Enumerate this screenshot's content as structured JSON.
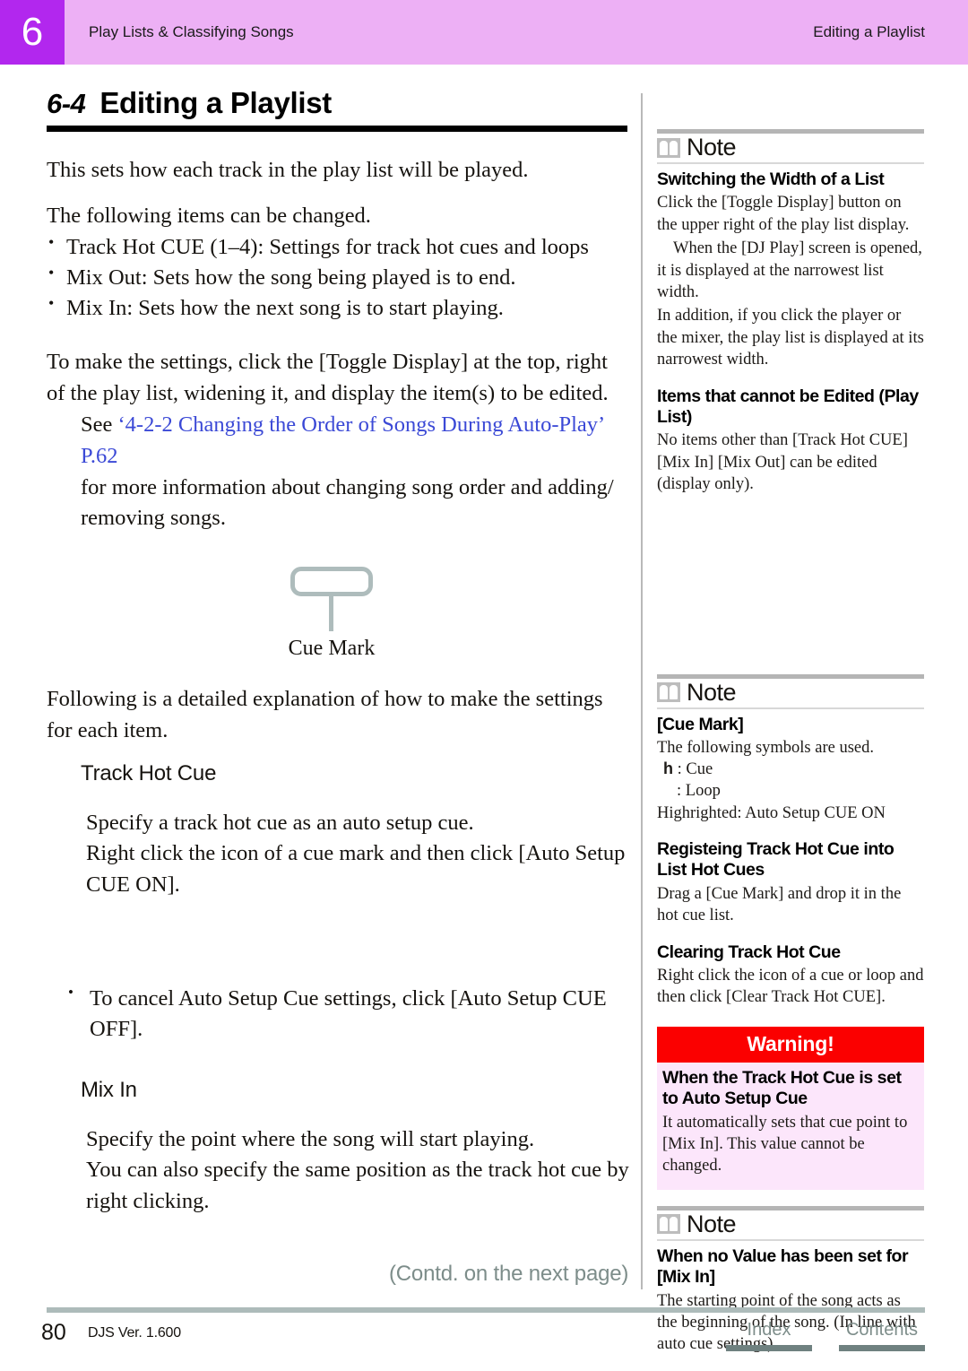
{
  "header": {
    "chapter_number": "6",
    "chapter_title": "Play Lists & Classifying Songs",
    "section_title": "Editing a Playlist",
    "band_color": "#edb0f5",
    "tab_color": "#b227ee"
  },
  "main": {
    "section_number": "6-4",
    "section_name": "Editing a Playlist",
    "intro": "This sets how each track in the play list will be played.",
    "items_lead": "The following items can be changed.",
    "bullets": [
      "Track Hot CUE (1–4): Settings for track hot cues and loops",
      "Mix Out: Sets how the song being played is to end.",
      "Mix In: Sets how the next song is to start playing."
    ],
    "settings_para": "To make the settings, click the [Toggle Display] at the top, right of the play list, widening it, and display the item(s) to be edited.",
    "see_prefix": "See ",
    "see_link": "‘4-2-2 Changing the Order of Songs During Auto-Play’ P.62",
    "see_suffix": "for more information about changing song order and adding/ removing songs.",
    "link_color": "#3b49d6",
    "figure": {
      "icon_name": "cue-mark-icon",
      "caption": "Cue Mark",
      "icon_color": "#aebcbc"
    },
    "detail_para": "Following is a detailed explanation of how to make the settings for each item.",
    "track_hot_cue": {
      "heading": "Track Hot Cue",
      "line1": "Specify a track hot cue as an auto setup cue.",
      "line2": "Right click the icon of a cue mark and then click [Auto Setup CUE ON].",
      "cancel_bullet": "To cancel Auto Setup Cue settings, click [Auto Setup CUE OFF]."
    },
    "mix_in": {
      "heading": "Mix In",
      "line1": "Specify the point where the song will start playing.",
      "line2": "You can also specify the same position as the track hot cue by right clicking."
    }
  },
  "sidebar": {
    "note1": {
      "label": "Note",
      "sections": [
        {
          "heading": "Switching the Width of a List",
          "paras": [
            "Click the [Toggle Display] button on the upper right of the play list display.",
            "When the [DJ Play] screen is opened, it is displayed at the narrowest list width.",
            "In addition, if you click the player or the mixer, the play list is displayed at its narrowest width."
          ]
        },
        {
          "heading": "Items that cannot be Edited (Play List)",
          "paras": [
            "No items other than [Track Hot CUE] [Mix In] [Mix Out] can be edited (display only)."
          ]
        }
      ]
    },
    "note2": {
      "label": "Note",
      "sections": [
        {
          "heading": "[Cue Mark]",
          "paras": [
            "The following symbols are used."
          ],
          "symbols": [
            {
              "glyph": "h",
              "text": ": Cue"
            },
            {
              "glyph": "",
              "text": ": Loop"
            }
          ],
          "footnote": "Highrighted: Auto Setup CUE ON"
        },
        {
          "heading": "Registeing Track Hot Cue into List Hot Cues",
          "paras": [
            "Drag a [Cue Mark] and drop it in the hot cue list."
          ]
        },
        {
          "heading": "Clearing Track Hot Cue",
          "paras": [
            "Right click the icon of a cue or loop and then click [Clear Track Hot CUE]."
          ]
        }
      ]
    },
    "warning": {
      "label": "Warning!",
      "heading": "When the Track Hot Cue is set to Auto Setup Cue",
      "body": "It automatically sets that cue point to [Mix In]. This value cannot be changed.",
      "header_color": "#fb0000",
      "body_color": "#fce6fb"
    },
    "note3": {
      "label": "Note",
      "sections": [
        {
          "heading": "When no Value has been set for [Mix In]",
          "paras": [
            "The starting point of the song acts as the beginning of the song. (In line with auto cue settings)"
          ]
        }
      ]
    }
  },
  "footer": {
    "contd": "(Contd. on the next page)",
    "page_number": "80",
    "version": "DJS Ver.  1.600",
    "index_label": "Index",
    "contents_label": "Contents"
  }
}
